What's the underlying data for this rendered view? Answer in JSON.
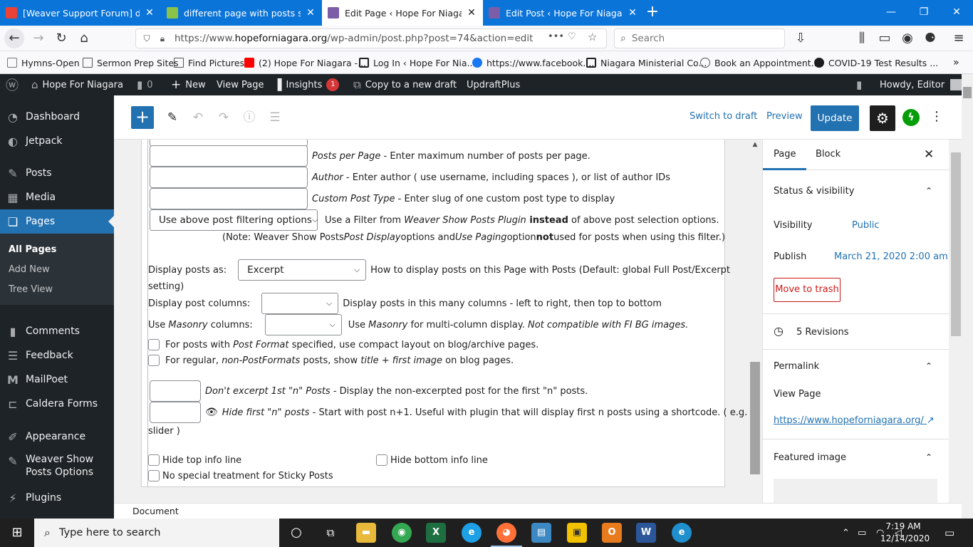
{
  "browser": {
    "tabs": [
      {
        "title": "[Weaver Support Forum] differ",
        "favicon_color": "#ea4335"
      },
      {
        "title": "different page with posts setup",
        "favicon_color": "#8bc34a"
      },
      {
        "title": "Edit Page ‹ Hope For Niagara —",
        "favicon_color": "#7b5ea7"
      },
      {
        "title": "Edit Post ‹ Hope For Niagara —",
        "favicon_color": "#7b5ea7"
      }
    ],
    "url_prefix": "https://www.",
    "url_domain": "hopeforniagara.org",
    "url_path": "/wp-admin/post.php?post=74&action=edit",
    "search_placeholder": "Search",
    "bookmarks": [
      "Hymns-Open",
      "Sermon Prep Sites",
      "Find Pictures",
      "(2) Hope For Niagara -...",
      "Log In ‹ Hope For Nia...",
      "https://www.facebook....",
      "Niagara Ministerial Co...",
      "Book an Appointment...",
      "COVID-19 Test Results ..."
    ]
  },
  "adminbar": {
    "site_name": "Hope For Niagara",
    "comments_count": "0",
    "new_label": "New",
    "view_page": "View Page",
    "insights": "Insights",
    "insights_badge": "1",
    "copy_draft": "Copy to a new draft",
    "updraft": "UpdraftPlus",
    "howdy": "Howdy, Editor"
  },
  "sidebar": {
    "items": [
      {
        "label": "Dashboard",
        "icon": "dashboard-icon"
      },
      {
        "label": "Jetpack",
        "icon": "jetpack-icon"
      },
      {
        "label": "Posts",
        "icon": "pin-icon"
      },
      {
        "label": "Media",
        "icon": "media-icon"
      },
      {
        "label": "Pages",
        "icon": "pages-icon"
      },
      {
        "label": "Comments",
        "icon": "comments-icon"
      },
      {
        "label": "Feedback",
        "icon": "feedback-icon"
      },
      {
        "label": "MailPoet",
        "icon": "mailpoet-icon"
      },
      {
        "label": "Caldera Forms",
        "icon": "caldera-icon"
      },
      {
        "label": "Appearance",
        "icon": "brush-icon"
      },
      {
        "label": "Weaver Show Posts Options",
        "line1": "Weaver Show",
        "line2": "Posts Options",
        "icon": "pin-icon"
      },
      {
        "label": "Plugins",
        "icon": "plugins-icon"
      }
    ],
    "pages_sub": [
      "All Pages",
      "Add New",
      "Tree View"
    ]
  },
  "editor": {
    "switch_to_draft": "Switch to draft",
    "preview": "Preview",
    "update": "Update",
    "document_label": "Document"
  },
  "metabox": {
    "posts_per_page_name": "Posts per Page",
    "posts_per_page_desc": " - Enter maximum number of posts per page.",
    "author_name": "Author",
    "author_desc": " - Enter author ( use username, including spaces ), or list of author IDs",
    "cpt_name": "Custom Post Type",
    "cpt_desc": " - Enter slug of one custom post type to display",
    "filter_select": "Use above post filtering options",
    "filter_desc_1": "Use a Filter from ",
    "filter_desc_plugin": "Weaver Show Posts Plugin",
    "filter_desc_instead": " instead",
    "filter_desc_2": " of above post selection options.",
    "note_1": "(Note: Weaver Show Posts ",
    "note_post_display": "Post Display",
    "note_2": " options and ",
    "note_use_paging": "Use Paging",
    "note_3": " option ",
    "note_not": "not",
    "note_4": " used for posts when using this filter.)",
    "display_as_label": "Display posts as:",
    "display_as_value": "Excerpt",
    "display_as_desc_1": "How to display posts on this Page with Posts (Default: global Full Post/Excerpt",
    "display_as_desc_2": "setting)",
    "columns_label": "Display post columns:",
    "columns_desc": "Display posts in this many columns - left to right, then top to bottom",
    "masonry_label_1": "Use ",
    "masonry_label_i": "Masonry",
    "masonry_label_2": " columns:",
    "masonry_desc_1": "Use ",
    "masonry_desc_i": "Masonry",
    "masonry_desc_2": " for multi-column display. ",
    "masonry_desc_note": "Not compatible with FI BG images.",
    "postformat_1": "For posts with ",
    "postformat_i": "Post Format",
    "postformat_2": " specified, use compact layout on blog/archive pages.",
    "regular_1": "For regular, ",
    "regular_i1": "non-PostFormats",
    "regular_2": " posts, show ",
    "regular_i2": "title + first image",
    "regular_3": " on blog pages.",
    "dont_excerpt_name": "Don't excerpt 1st \"n\" Posts",
    "dont_excerpt_desc": " - Display the non-excerpted post for the first \"n\" posts.",
    "hide_first_name": "Hide first \"n\" posts",
    "hide_first_desc": " - Start with post n+1. Useful with plugin that will display first n posts using a shortcode. ( e.g., Post",
    "hide_first_desc_2": "slider )",
    "hide_top": "Hide top info line",
    "hide_bottom": "Hide bottom info line",
    "no_sticky": "No special treatment for Sticky Posts"
  },
  "settings_panel": {
    "tab_page": "Page",
    "tab_block": "Block",
    "status_title": "Status & visibility",
    "visibility_label": "Visibility",
    "visibility_value": "Public",
    "publish_label": "Publish",
    "publish_value": "March 21, 2020 2:00 am",
    "move_to_trash": "Move to trash",
    "revisions": "5 Revisions",
    "permalink_title": "Permalink",
    "view_page": "View Page",
    "permalink_url": "https://www.hopeforniagara.org/",
    "featured_title": "Featured image"
  },
  "taskbar": {
    "search_placeholder": "Type here to search",
    "time": "7:19 AM",
    "date": "12/14/2020"
  }
}
